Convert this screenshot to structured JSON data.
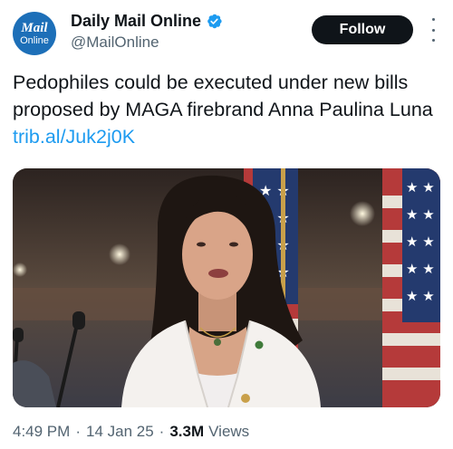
{
  "account": {
    "avatar_line1": "Mail",
    "avatar_line2": "Online",
    "display_name": "Daily Mail Online",
    "verified_icon": "verified-badge-icon",
    "handle": "@MailOnline",
    "follow_label": "Follow"
  },
  "tweet": {
    "text": "Pedophiles could be executed under new bills proposed by MAGA firebrand Anna Paulina Luna ",
    "link": "trib.al/Juk2j0K",
    "media_icon": "photo-woman-speaking-flags",
    "time": "4:49 PM",
    "date": "14 Jan 25",
    "views_count": "3.3M",
    "views_label": "Views"
  },
  "colors": {
    "accent": "#1d9bf0",
    "text": "#0f1419",
    "muted": "#536471",
    "follow_bg": "#0f1419",
    "avatar_bg": "#1d6fb8"
  }
}
